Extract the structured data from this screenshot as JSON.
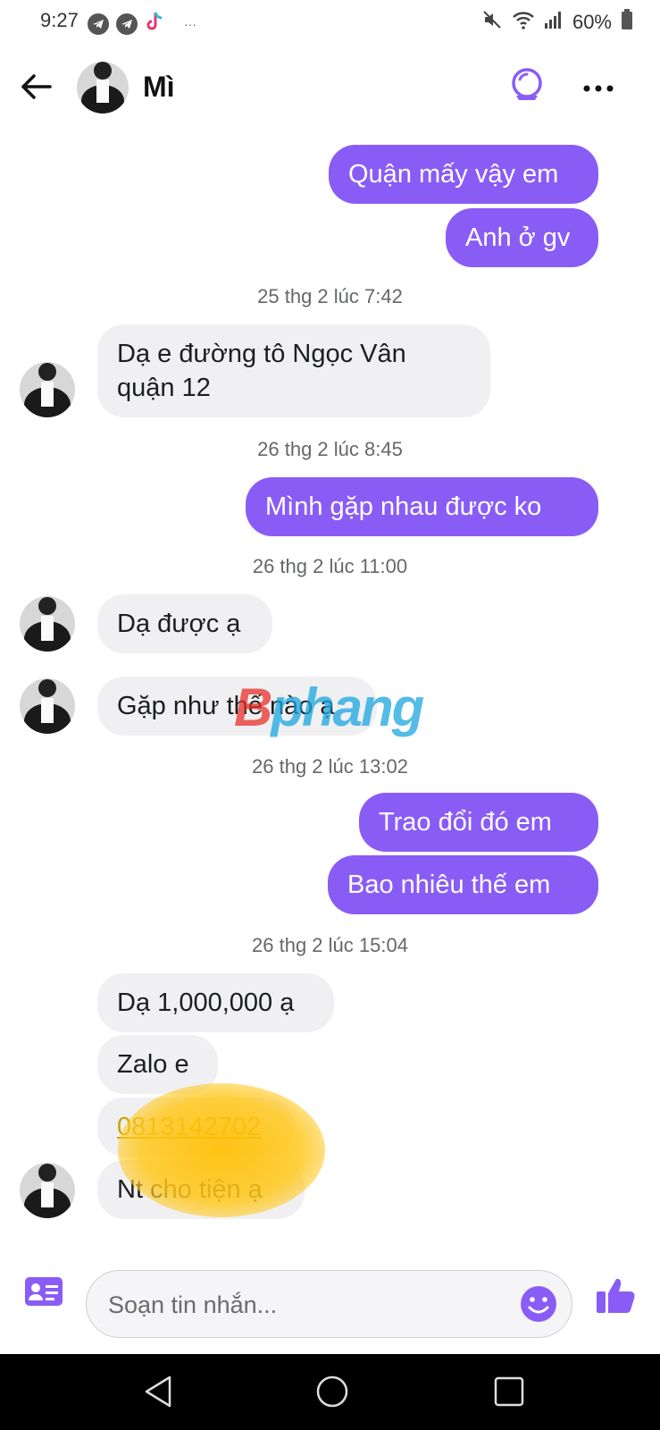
{
  "status_bar": {
    "time": "9:27",
    "battery": "60%",
    "dots": "···"
  },
  "header": {
    "contact_name": "Mì"
  },
  "messages": {
    "m1": "Quận mấy vậy em",
    "m2": "Anh ở gv",
    "ts1": "25 thg 2 lúc 7:42",
    "m3_line1": "Dạ e đường tô Ngọc Vân",
    "m3_line2": "quận 12",
    "ts2": "26 thg 2 lúc 8:45",
    "m4": "Mình gặp nhau được ko",
    "ts3": "26 thg 2 lúc 11:00",
    "m5": "Dạ được ạ",
    "m6": "Gặp như thế nào ạ",
    "ts4": "26 thg 2 lúc 13:02",
    "m7": "Trao đổi đó em",
    "m8": "Bao nhiêu thế em",
    "ts5": "26 thg 2 lúc 15:04",
    "m9": "Dạ 1,000,000 ạ",
    "m10": "Zalo e",
    "m11": "0813142702",
    "m12": "Nt cho tiện ạ"
  },
  "watermark": {
    "part1": "B",
    "part2": "phang"
  },
  "composer": {
    "placeholder": "Soạn tin nhắn..."
  },
  "colors": {
    "accent": "#8a5cf6",
    "incoming_bg": "#f0f0f2"
  },
  "icons": [
    "back-arrow-icon",
    "phone-call-icon",
    "more-dots-icon",
    "contact-card-icon",
    "emoji-icon",
    "thumbs-up-icon"
  ]
}
